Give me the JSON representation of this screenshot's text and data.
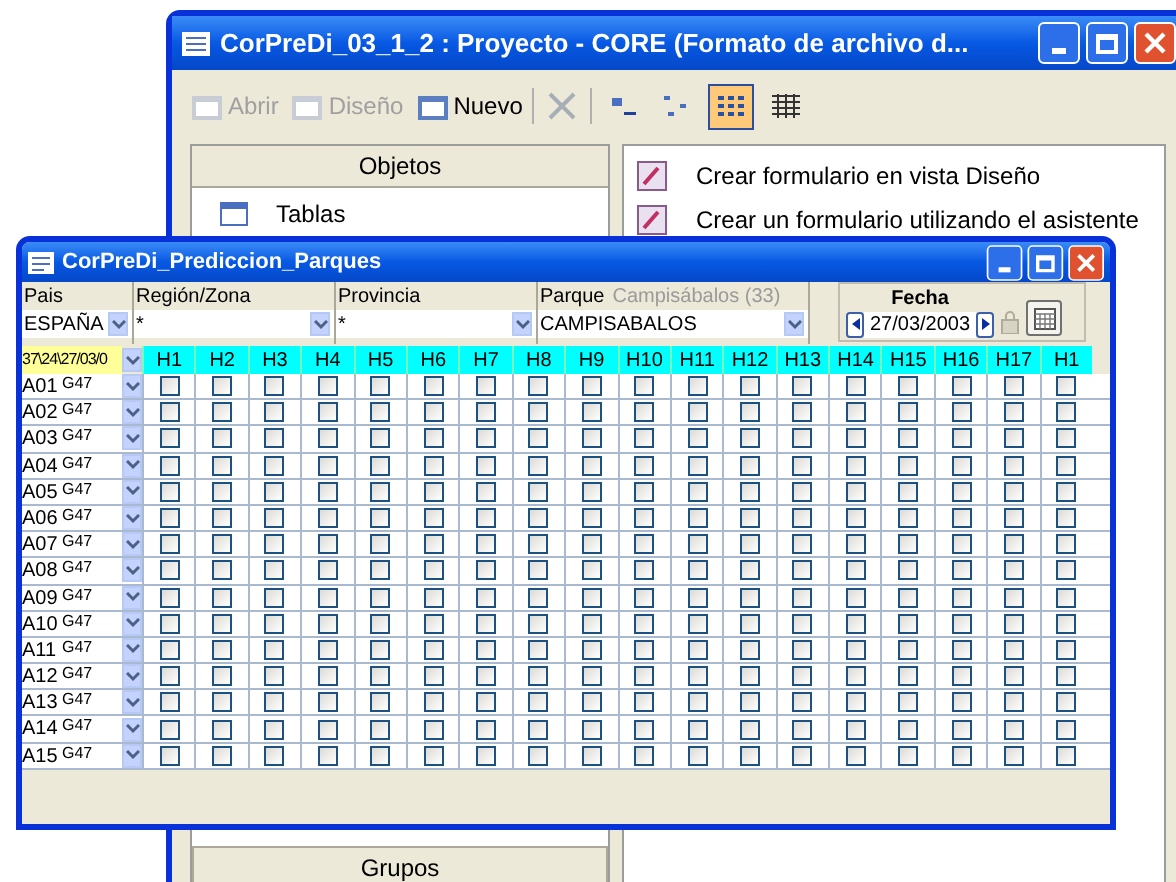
{
  "back_window": {
    "title": "CorPreDi_03_1_2 : Proyecto - CORE (Formato de archivo d...",
    "toolbar": [
      {
        "kind": "button",
        "label": "Abrir",
        "disabled": true
      },
      {
        "kind": "button",
        "label": "Diseño",
        "disabled": true
      },
      {
        "kind": "button",
        "label": "Nuevo",
        "disabled": false
      },
      {
        "kind": "delete",
        "disabled": true
      },
      {
        "kind": "large-icons",
        "selected": false
      },
      {
        "kind": "small-icons",
        "selected": false
      },
      {
        "kind": "list",
        "selected": true
      },
      {
        "kind": "details",
        "selected": false
      }
    ],
    "objects_header": "Objetos",
    "objects": [
      "Tablas"
    ],
    "groups_header": "Grupos",
    "list": [
      "Crear formulario en vista Diseño",
      "Crear un formulario utilizando el asistente"
    ]
  },
  "front_window": {
    "title": "CorPreDi_Prediccion_Parques",
    "filters": [
      {
        "label": "Pais",
        "value": "ESPAÑA"
      },
      {
        "label": "Región/Zona",
        "value": "*"
      },
      {
        "label": "Provincia",
        "value": "*"
      },
      {
        "label": "Parque",
        "hint": "Campisábalos (33)",
        "value": "CAMPISABALOS"
      }
    ],
    "date": {
      "label": "Fecha",
      "value": "27/03/2003"
    },
    "grid": {
      "corner": "37\\24\\27/03/0",
      "columns": [
        "H1",
        "H2",
        "H3",
        "H4",
        "H5",
        "H6",
        "H7",
        "H8",
        "H9",
        "H10",
        "H11",
        "H12",
        "H13",
        "H14",
        "H15",
        "H16",
        "H17",
        "H1"
      ],
      "rows": [
        {
          "id": "A01",
          "group": "G47",
          "checks": [
            false,
            false,
            false,
            false,
            false,
            false,
            false,
            false,
            false,
            false,
            false,
            false,
            false,
            false,
            false,
            false,
            false,
            false
          ]
        },
        {
          "id": "A02",
          "group": "G47",
          "checks": [
            false,
            false,
            false,
            false,
            false,
            false,
            false,
            false,
            false,
            false,
            false,
            false,
            false,
            false,
            false,
            false,
            false,
            false
          ]
        },
        {
          "id": "A03",
          "group": "G47",
          "checks": [
            false,
            false,
            false,
            false,
            false,
            false,
            false,
            false,
            false,
            false,
            false,
            false,
            false,
            false,
            false,
            false,
            false,
            false
          ]
        },
        {
          "id": "A04",
          "group": "G47",
          "checks": [
            false,
            false,
            false,
            false,
            false,
            false,
            false,
            false,
            false,
            false,
            false,
            false,
            false,
            false,
            false,
            false,
            false,
            false
          ]
        },
        {
          "id": "A05",
          "group": "G47",
          "checks": [
            false,
            false,
            false,
            false,
            false,
            false,
            false,
            false,
            false,
            false,
            false,
            false,
            false,
            false,
            false,
            false,
            false,
            false
          ]
        },
        {
          "id": "A06",
          "group": "G47",
          "checks": [
            false,
            false,
            false,
            false,
            false,
            false,
            false,
            false,
            false,
            false,
            false,
            false,
            false,
            false,
            false,
            false,
            false,
            false
          ]
        },
        {
          "id": "A07",
          "group": "G47",
          "checks": [
            false,
            false,
            false,
            false,
            false,
            false,
            false,
            false,
            false,
            false,
            false,
            false,
            false,
            false,
            false,
            false,
            false,
            false
          ]
        },
        {
          "id": "A08",
          "group": "G47",
          "checks": [
            false,
            false,
            false,
            false,
            false,
            false,
            false,
            false,
            false,
            false,
            false,
            false,
            false,
            false,
            false,
            false,
            false,
            false
          ]
        },
        {
          "id": "A09",
          "group": "G47",
          "checks": [
            false,
            false,
            false,
            false,
            false,
            false,
            false,
            false,
            false,
            false,
            false,
            false,
            false,
            false,
            false,
            false,
            false,
            false
          ]
        },
        {
          "id": "A10",
          "group": "G47",
          "checks": [
            false,
            false,
            false,
            false,
            false,
            false,
            false,
            false,
            false,
            false,
            false,
            false,
            false,
            false,
            false,
            false,
            false,
            false
          ]
        },
        {
          "id": "A11",
          "group": "G47",
          "checks": [
            false,
            false,
            false,
            false,
            false,
            false,
            false,
            false,
            false,
            false,
            false,
            false,
            false,
            false,
            false,
            false,
            false,
            false
          ]
        },
        {
          "id": "A12",
          "group": "G47",
          "checks": [
            false,
            false,
            false,
            false,
            false,
            false,
            false,
            false,
            false,
            false,
            false,
            false,
            false,
            false,
            false,
            false,
            false,
            false
          ]
        },
        {
          "id": "A13",
          "group": "G47",
          "checks": [
            false,
            false,
            false,
            false,
            false,
            false,
            false,
            false,
            false,
            false,
            false,
            false,
            false,
            false,
            false,
            false,
            false,
            false
          ]
        },
        {
          "id": "A14",
          "group": "G47",
          "checks": [
            false,
            false,
            false,
            false,
            false,
            false,
            false,
            false,
            false,
            false,
            false,
            false,
            false,
            false,
            false,
            false,
            false,
            false
          ]
        },
        {
          "id": "A15",
          "group": "G47",
          "checks": [
            false,
            false,
            false,
            false,
            false,
            false,
            false,
            false,
            false,
            false,
            false,
            false,
            false,
            false,
            false,
            false,
            false,
            false
          ]
        }
      ]
    }
  }
}
